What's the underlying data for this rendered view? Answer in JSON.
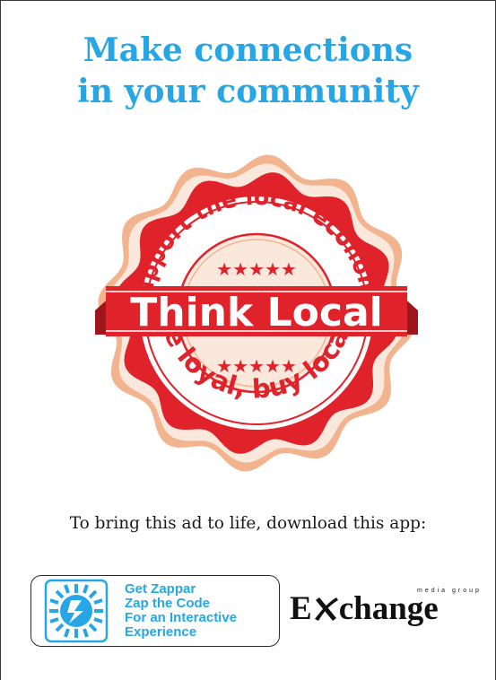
{
  "headline": {
    "line1": "Make connections",
    "line2": "in your community"
  },
  "seal": {
    "arc_top": "Support the local economy",
    "banner": "Think Local",
    "arc_bottom": "Be loyal, buy local!",
    "colors": {
      "red": "#e0222b",
      "dark_red": "#9e151c",
      "peach": "#f2b48f",
      "cream": "#fbe8dc"
    }
  },
  "prompt": "To bring this ad to life, download this app:",
  "zappar": {
    "icon": "zappar-logo-icon",
    "lines": [
      "Get Zappar",
      "Zap the Code",
      "For an Interactive",
      "Experience"
    ],
    "color": "#27a6e6"
  },
  "exchange": {
    "tagline": "media group",
    "word_pre": "E",
    "word_post": "change",
    "x_icon": "x-swoosh-icon"
  }
}
